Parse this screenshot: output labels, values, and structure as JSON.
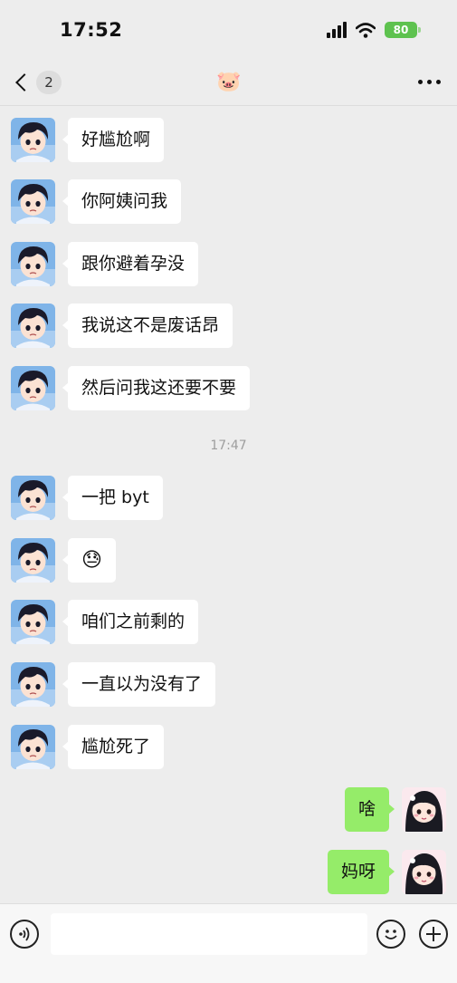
{
  "status_bar": {
    "time": "17:52",
    "battery": "80"
  },
  "nav": {
    "unread_count": "2",
    "title_emoji": "🐷"
  },
  "messages_before": [
    {
      "text": "好尴尬啊"
    },
    {
      "text": "你阿姨问我"
    },
    {
      "text": "跟你避着孕没"
    },
    {
      "text": "我说这不是废话昂"
    },
    {
      "text": "然后问我这还要不要"
    }
  ],
  "timestamp": "17:47",
  "messages_after": [
    {
      "text": "一把 byt"
    },
    {
      "text": "😓"
    },
    {
      "text": "咱们之前剩的"
    },
    {
      "text": "一直以为没有了"
    },
    {
      "text": "尴尬死了"
    }
  ],
  "my_messages": [
    {
      "text": "啥"
    },
    {
      "text": "妈呀"
    }
  ],
  "input": {
    "placeholder": ""
  },
  "colors": {
    "background": "#ededed",
    "my_bubble": "#95ec69",
    "their_bubble": "#ffffff",
    "battery": "#5ec24f"
  }
}
